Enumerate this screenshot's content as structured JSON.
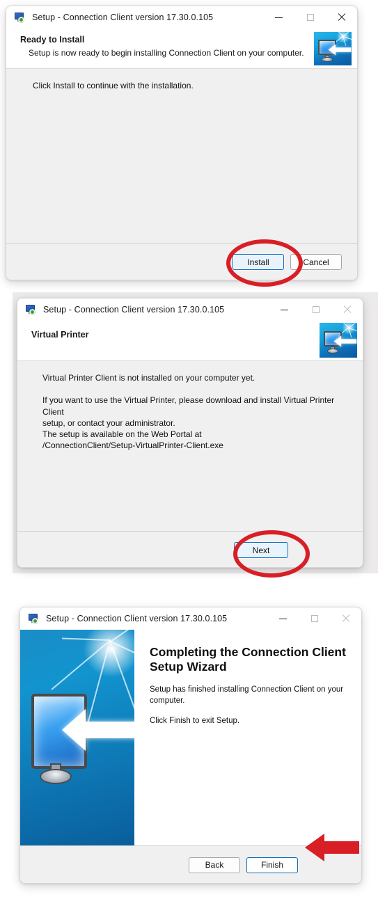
{
  "app": {
    "window_title": "Setup - Connection Client version 17.30.0.105",
    "icon": "setup-monitor-icon",
    "accent_blue": "#0a6cc4",
    "annotation_red": "#d81f26",
    "body_background": "#f0f0f0"
  },
  "captions": {
    "minimize": "minimize-icon",
    "maximize": "maximize-icon",
    "close": "close-icon"
  },
  "windows": [
    {
      "id": "ready-to-install",
      "title": "Setup - Connection Client version 17.30.0.105",
      "header": {
        "heading": "Ready to Install",
        "subheading": "Setup is now ready to begin installing Connection Client on your computer.",
        "icon": "connection-client-badge-icon"
      },
      "body_text": "Click Install to continue with the installation.",
      "buttons": [
        {
          "label": "Install",
          "state": "focused",
          "name": "install-button"
        },
        {
          "label": "Cancel",
          "state": "normal",
          "name": "cancel-button"
        }
      ],
      "annotation": "red-ellipse-around-install-button"
    },
    {
      "id": "virtual-printer",
      "title": "Setup - Connection Client version 17.30.0.105",
      "header": {
        "heading": "Virtual Printer",
        "subheading": "",
        "icon": "connection-client-badge-icon"
      },
      "body_text": "Virtual Printer Client is not installed on your computer yet.\n\nIf you want to use the Virtual Printer, please download and install Virtual Printer Client\nsetup, or contact your administrator.\nThe setup is available on the Web Portal at\n/ConnectionClient/Setup-VirtualPrinter-Client.exe",
      "buttons": [
        {
          "label": "Next",
          "state": "focused",
          "name": "next-button"
        }
      ],
      "annotation": "red-ellipse-around-next-button"
    },
    {
      "id": "completing-wizard",
      "title": "Setup - Connection Client version 17.30.0.105",
      "wizard": {
        "heading": "Completing the Connection Client Setup Wizard",
        "paragraph_1": "Setup has finished installing Connection Client on your computer.",
        "paragraph_2": "Click Finish to exit Setup.",
        "side_image": "connection-client-splash-image"
      },
      "buttons": [
        {
          "label": "Back",
          "state": "normal",
          "name": "back-button"
        },
        {
          "label": "Finish",
          "state": "focused",
          "name": "finish-button"
        }
      ],
      "annotation": "red-arrow-pointing-at-finish-button"
    }
  ]
}
